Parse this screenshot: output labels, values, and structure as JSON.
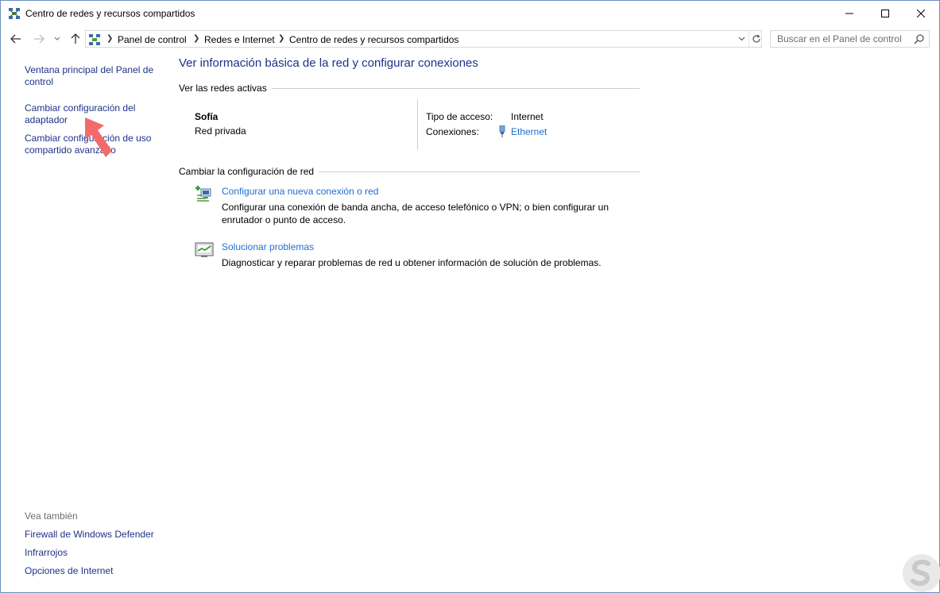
{
  "window": {
    "title": "Centro de redes y recursos compartidos"
  },
  "address_bar": {
    "breadcrumbs": [
      "Panel de control",
      "Redes e Internet",
      "Centro de redes y recursos compartidos"
    ],
    "search_placeholder": "Buscar en el Panel de control"
  },
  "left_pane": {
    "links": [
      "Ventana principal del Panel de control",
      "Cambiar configuración del adaptador",
      "Cambiar configuración de uso compartido avanzado"
    ],
    "see_also_title": "Vea también",
    "see_also_links": [
      "Firewall de Windows Defender",
      "Infrarrojos",
      "Opciones de Internet"
    ]
  },
  "main": {
    "title": "Ver información básica de la red y configurar conexiones",
    "active_networks_heading": "Ver las redes activas",
    "network": {
      "name": "Sofía",
      "type": "Red privada",
      "access_type_label": "Tipo de acceso:",
      "access_type_value": "Internet",
      "connections_label": "Conexiones:",
      "connection_name": "Ethernet"
    },
    "change_settings_heading": "Cambiar la configuración de red",
    "tasks": [
      {
        "link": "Configurar una nueva conexión o red",
        "description": "Configurar una conexión de banda ancha, de acceso telefónico o VPN; o bien configurar un enrutador o punto de acceso.",
        "icon": "new-connection-icon"
      },
      {
        "link": "Solucionar problemas",
        "description": "Diagnosticar y reparar problemas de red u obtener información de solución de problemas.",
        "icon": "troubleshoot-icon"
      }
    ]
  },
  "colors": {
    "link_dark": "#1e3287",
    "link": "#1e6fcf",
    "annotation_arrow": "#f26b6b"
  }
}
